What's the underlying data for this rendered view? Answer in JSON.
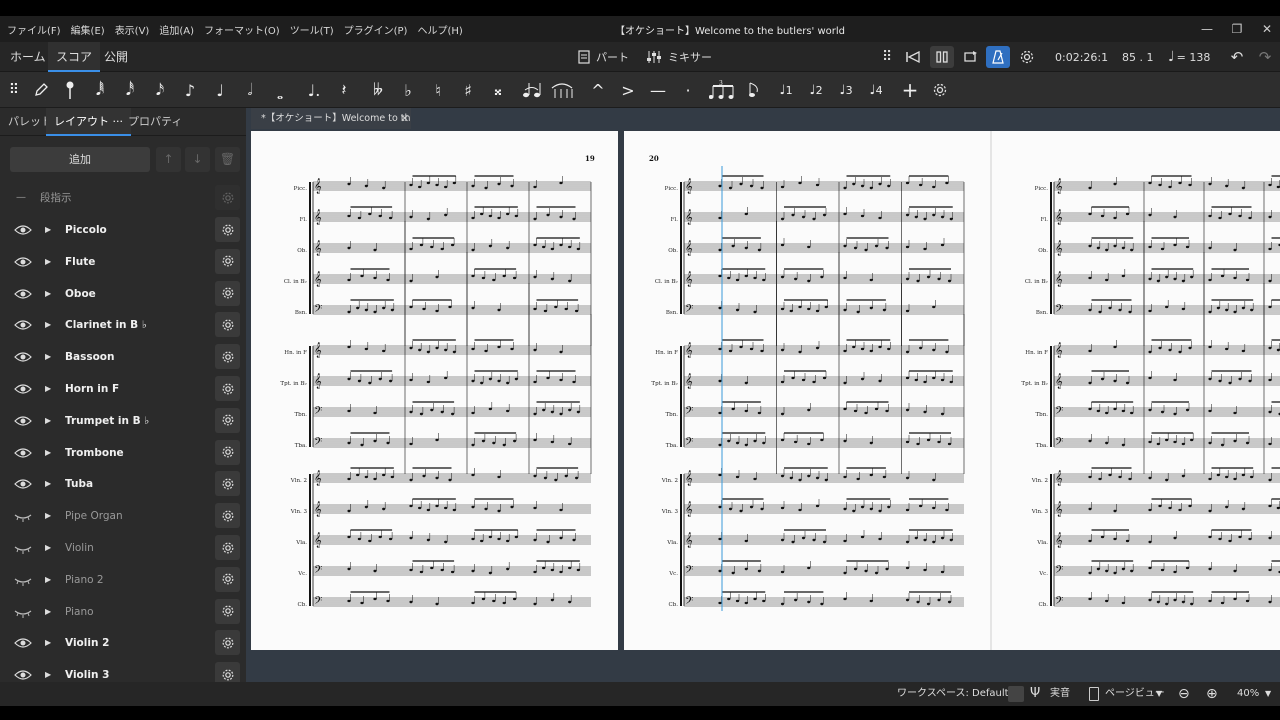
{
  "window": {
    "title": "【オケショート】Welcome to the butlers' world"
  },
  "menu": [
    "ファイル(F)",
    "編集(E)",
    "表示(V)",
    "追加(A)",
    "フォーマット(O)",
    "ツール(T)",
    "プラグイン(P)",
    "ヘルプ(H)"
  ],
  "tabs": {
    "home": "ホーム",
    "score": "スコア",
    "publish": "公開"
  },
  "view": {
    "parts": "パート",
    "mixer": "ミキサー"
  },
  "playback": {
    "time": "0:02:26:1",
    "position": "85 . 1",
    "tempo": "= 138"
  },
  "palette_tuplet": "3",
  "voices": [
    "1",
    "2",
    "3",
    "4"
  ],
  "sidebar": {
    "tabs": [
      "パレット",
      "レイアウト",
      "プロパティ"
    ],
    "more": "···",
    "add_label": "追加",
    "system_marker": "段指示",
    "instruments": [
      {
        "label": "Piccolo",
        "visible": true
      },
      {
        "label": "Flute",
        "visible": true
      },
      {
        "label": "Oboe",
        "visible": true
      },
      {
        "label": "Clarinet in B ♭",
        "visible": true
      },
      {
        "label": "Bassoon",
        "visible": true
      },
      {
        "label": "Horn in F",
        "visible": true
      },
      {
        "label": "Trumpet in B ♭",
        "visible": true
      },
      {
        "label": "Trombone",
        "visible": true
      },
      {
        "label": "Tuba",
        "visible": true
      },
      {
        "label": "Pipe Organ",
        "visible": false
      },
      {
        "label": "Violin",
        "visible": false
      },
      {
        "label": "Piano 2",
        "visible": false
      },
      {
        "label": "Piano",
        "visible": false
      },
      {
        "label": "Violin 2",
        "visible": true
      },
      {
        "label": "Violin 3",
        "visible": true
      }
    ]
  },
  "document": {
    "tab_label": "*【オケショート】Welcome to th...",
    "close": "✕"
  },
  "score": {
    "staff_labels": [
      "Picc.",
      "Fl.",
      "Ob.",
      "Cl. in B♭",
      "Bsn.",
      "Hn. in F",
      "Tpt. in B♭",
      "Tbn.",
      "Tba.",
      "Vln. 2",
      "Vln. 3",
      "Vla.",
      "Vc.",
      "Cb."
    ],
    "page1_number": "19",
    "page2_number": "20"
  },
  "status": {
    "workspace": "ワークスペース: Default",
    "concert_pitch": "実音",
    "page_view": "ページビュー",
    "zoom": "40%"
  },
  "colors": {
    "accent": "#2f6fc0",
    "tab_underline": "#3a8fe8",
    "playback_cursor": "#3a9ad9"
  }
}
